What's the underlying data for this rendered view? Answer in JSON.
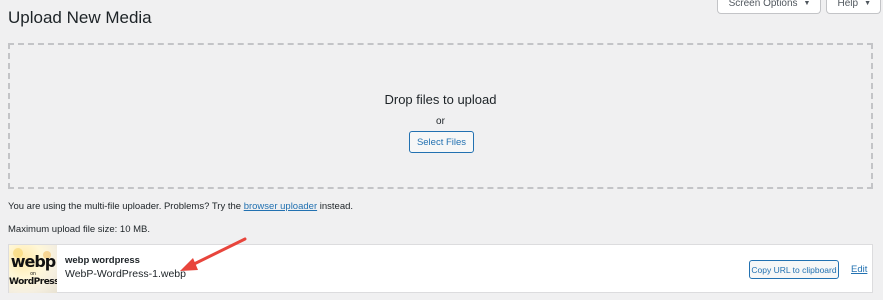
{
  "page": {
    "title": "Upload New Media"
  },
  "screen_meta": {
    "screen_options_label": "Screen Options",
    "help_label": "Help"
  },
  "uploader": {
    "drop_title": "Drop files to upload",
    "or_text": "or",
    "select_files_label": "Select Files"
  },
  "notes": {
    "multi_file_prefix": "You are using the multi-file uploader. Problems? Try the ",
    "browser_uploader_link": "browser uploader",
    "multi_file_suffix": " instead.",
    "max_size": "Maximum upload file size: 10 MB."
  },
  "media_item": {
    "title": "webp wordpress",
    "filename": "WebP-WordPress-1.webp",
    "thumbnail_text": {
      "line1": "webp",
      "line2": "on",
      "line3": "WordPress"
    },
    "copy_url_label": "Copy URL to clipboard",
    "edit_label": "Edit"
  },
  "colors": {
    "accent": "#2271b1",
    "background": "#f0f0f1",
    "annotation_arrow": "#e8453c"
  }
}
